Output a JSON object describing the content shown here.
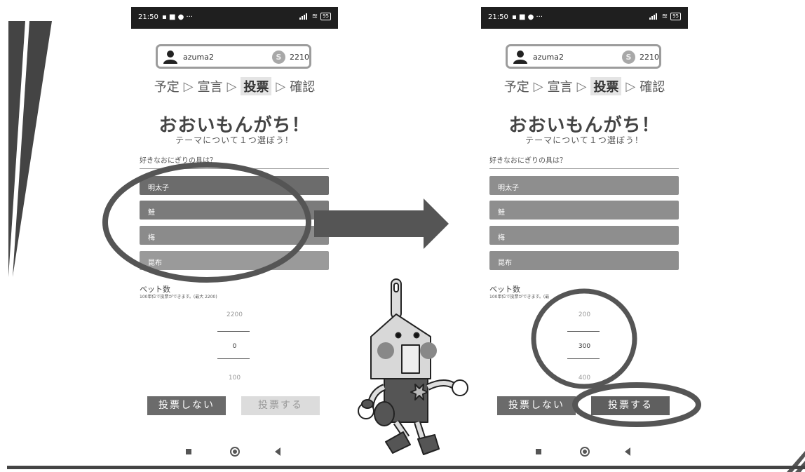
{
  "phones": [
    {
      "status": {
        "time": "21:50",
        "icons": " 🗑 ■◂ ● ···",
        "battery": "95"
      },
      "user": {
        "name": "azuma2",
        "coin_symbol": "S",
        "coins": "2210"
      },
      "steps": [
        "予定",
        "宣言",
        "投票",
        "確認"
      ],
      "step_separator": "▷",
      "active_step": "投票",
      "title": "おおいもんがち！",
      "subtitle": "テーマについて１つ選ぼう！",
      "question": "好きなおにぎりの具は？",
      "options": [
        "明太子",
        "鮭",
        "梅",
        "昆布"
      ],
      "bet_label": "ベット数",
      "bet_note": "100単位で投票ができます。(最大 2200)",
      "picker": {
        "above": "2200",
        "value": "0",
        "below": "100"
      },
      "buttons": {
        "no_vote": "投票しない",
        "vote": "投票する",
        "vote_enabled": false
      }
    },
    {
      "status": {
        "time": "21:50",
        "icons": " 🗑 ■◂ ● ···",
        "battery": "95"
      },
      "user": {
        "name": "azuma2",
        "coin_symbol": "S",
        "coins": "2210"
      },
      "steps": [
        "予定",
        "宣言",
        "投票",
        "確認"
      ],
      "step_separator": "▷",
      "active_step": "投票",
      "title": "おおいもんがち！",
      "subtitle": "テーマについて１つ選ぼう！",
      "question": "好きなおにぎりの具は？",
      "options": [
        "明太子",
        "鮭",
        "梅",
        "昆布"
      ],
      "bet_label": "ベット数",
      "bet_note": "100単位で投票ができます。(最",
      "picker": {
        "above": "200",
        "value": "300",
        "below": "400"
      },
      "buttons": {
        "no_vote": "投票しない",
        "vote": "投票する",
        "vote_enabled": true
      }
    }
  ],
  "colors": {
    "accent_dark": "#555555",
    "ellipse": "#555555",
    "arrow": "#555555"
  }
}
